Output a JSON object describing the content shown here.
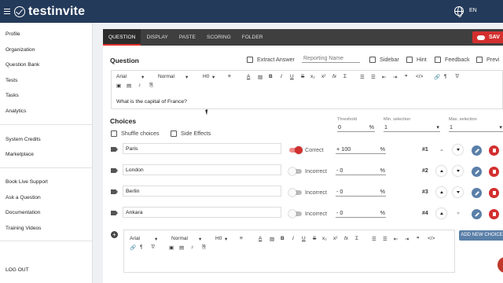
{
  "brand": {
    "name": "testinvite"
  },
  "header": {
    "language": "EN"
  },
  "sidebar": {
    "items": [
      {
        "label": "Profile"
      },
      {
        "label": "Organization"
      },
      {
        "label": "Question Bank"
      },
      {
        "label": "Tests"
      },
      {
        "label": "Tasks"
      },
      {
        "label": "Analytics"
      },
      {
        "label": "System Credits"
      },
      {
        "label": "Marketplace"
      },
      {
        "label": "Book Live Support"
      },
      {
        "label": "Ask a Question"
      },
      {
        "label": "Documentation"
      },
      {
        "label": "Training Videos"
      },
      {
        "label": "LOG OUT"
      }
    ]
  },
  "tabs": [
    {
      "label": "QUESTION"
    },
    {
      "label": "DISPLAY"
    },
    {
      "label": "PASTE"
    },
    {
      "label": "SCORING"
    },
    {
      "label": "FOLDER"
    }
  ],
  "save_label": "SAV",
  "question": {
    "title": "Question",
    "extract_answer": "Extract Answer",
    "reporting_name_placeholder": "Reporting Name",
    "options": [
      "Sidebar",
      "Hint",
      "Feedback",
      "Previ"
    ],
    "editor": {
      "font": "Arial",
      "style": "Normal",
      "heading": "H0",
      "text": "What is the capital of France?"
    }
  },
  "choices": {
    "title": "Choices",
    "shuffle_label": "Shuffle choices",
    "side_effects_label": "Side Effects",
    "threshold_label": "Threshold",
    "threshold_value": "0",
    "threshold_unit": "%",
    "min_selection_label": "Min. selection",
    "min_selection_value": "1",
    "max_selection_label": "Max. selection",
    "max_selection_value": "1",
    "rows": [
      {
        "text": "Paris",
        "status": "Correct",
        "correct": true,
        "score": "+ 100",
        "unit": "%",
        "num": "#1"
      },
      {
        "text": "London",
        "status": "Incorrect",
        "correct": false,
        "score": "- 0",
        "unit": "%",
        "num": "#2"
      },
      {
        "text": "Berlin",
        "status": "Incorrect",
        "correct": false,
        "score": "- 0",
        "unit": "%",
        "num": "#3"
      },
      {
        "text": "Ankara",
        "status": "Incorrect",
        "correct": false,
        "score": "- 0",
        "unit": "%",
        "num": "#4"
      }
    ],
    "new_editor": {
      "font": "Arial",
      "style": "Normal",
      "heading": "H0"
    },
    "add_button": "ADD NEW CHOICE"
  },
  "colors": {
    "header": "#243a5a",
    "accent_red": "#d32f2f",
    "edit_blue": "#5a7fa8"
  }
}
